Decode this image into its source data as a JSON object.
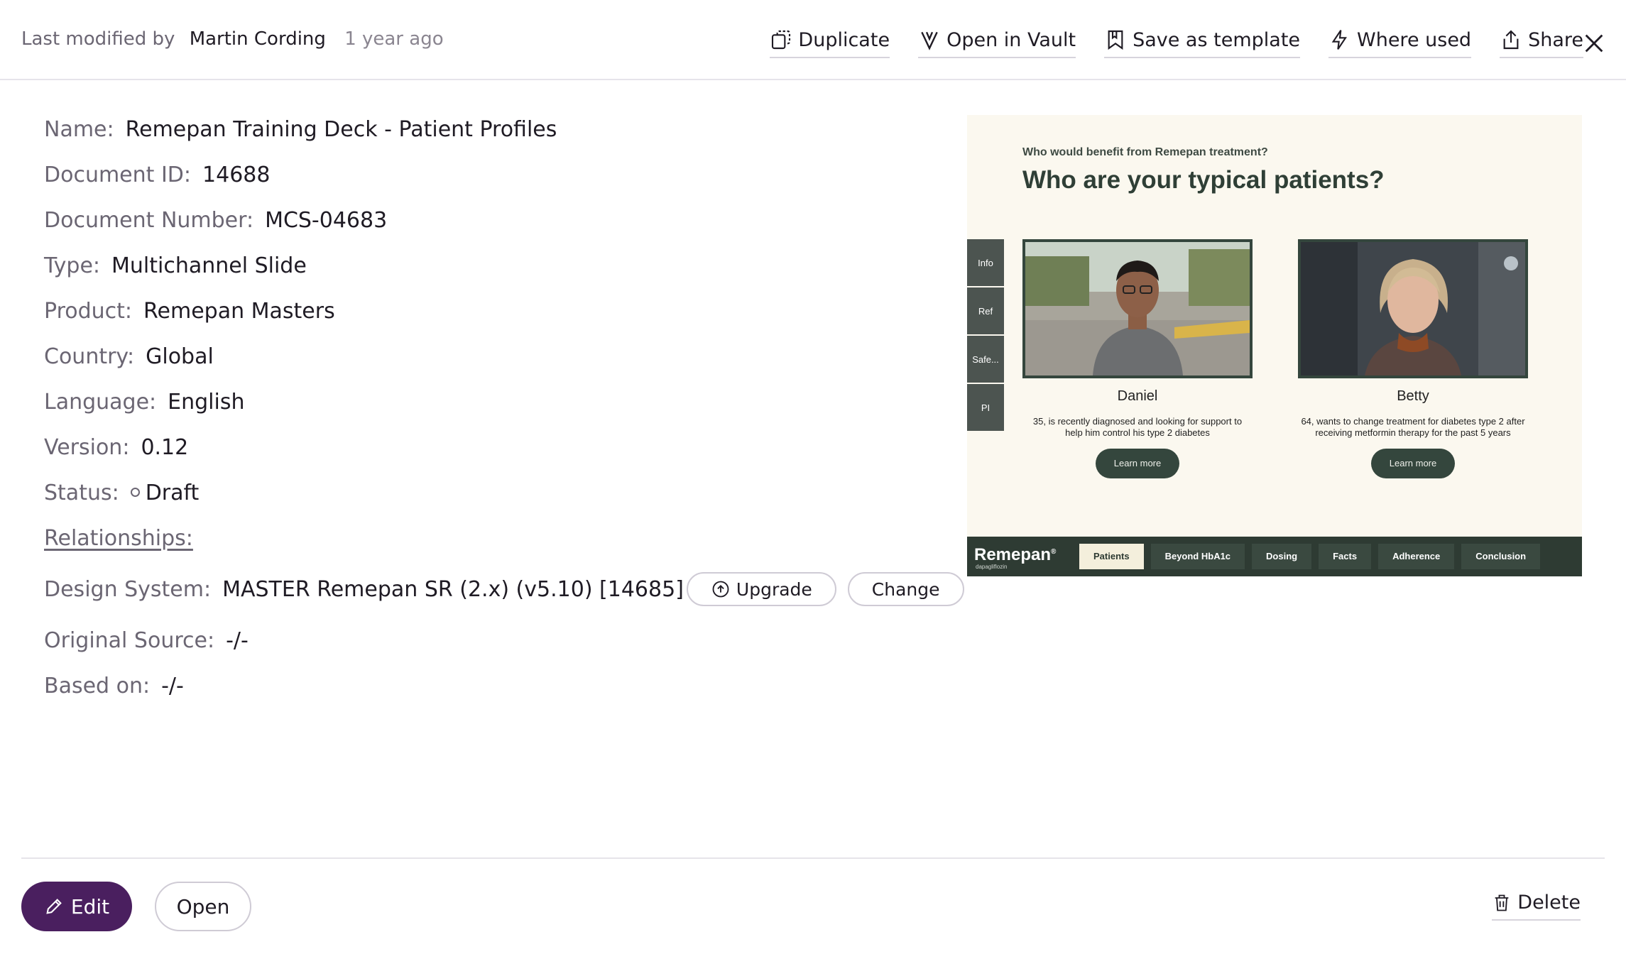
{
  "header": {
    "modified_label": "Last modified by",
    "modified_by": "Martin Cording",
    "modified_when": "1 year ago",
    "actions": {
      "duplicate": "Duplicate",
      "open_in_vault": "Open in Vault",
      "save_as_template": "Save as template",
      "where_used": "Where used",
      "share": "Share"
    }
  },
  "details": {
    "name_label": "Name:",
    "name": "Remepan Training Deck - Patient Profiles",
    "doc_id_label": "Document ID:",
    "doc_id": "14688",
    "doc_number_label": "Document Number:",
    "doc_number": "MCS-04683",
    "type_label": "Type:",
    "type": "Multichannel Slide",
    "product_label": "Product:",
    "product": "Remepan Masters",
    "country_label": "Country:",
    "country": "Global",
    "language_label": "Language:",
    "language": "English",
    "version_label": "Version:",
    "version": "0.12",
    "status_label": "Status:",
    "status": "Draft",
    "relationships_label": "Relationships:",
    "design_system_label": "Design System:",
    "design_system": "MASTER Remepan SR (2.x) (v5.10) [14685]",
    "upgrade_label": "Upgrade",
    "change_label": "Change",
    "original_source_label": "Original Source:",
    "original_source": "-/-",
    "based_on_label": "Based on:",
    "based_on": "-/-"
  },
  "preview": {
    "kicker": "Who would benefit from Remepan treatment?",
    "headline": "Who are your typical patients?",
    "side_tabs": [
      "Info",
      "Ref",
      "Safe...",
      "PI"
    ],
    "patients": [
      {
        "name": "Daniel",
        "description": "35, is recently diagnosed and looking for support to help him control his type 2 diabetes",
        "cta": "Learn more"
      },
      {
        "name": "Betty",
        "description": "64, wants to change treatment for diabetes type 2 after receiving metformin therapy for the past 5 years",
        "cta": "Learn more"
      }
    ],
    "brand": "Remepan",
    "brand_mark": "®",
    "brand_sub": "dapagliflozin",
    "nav": [
      "Patients",
      "Beyond HbA1c",
      "Dosing",
      "Facts",
      "Adherence",
      "Conclusion"
    ],
    "nav_active": "Patients"
  },
  "footer": {
    "edit_label": "Edit",
    "open_label": "Open",
    "delete_label": "Delete"
  }
}
